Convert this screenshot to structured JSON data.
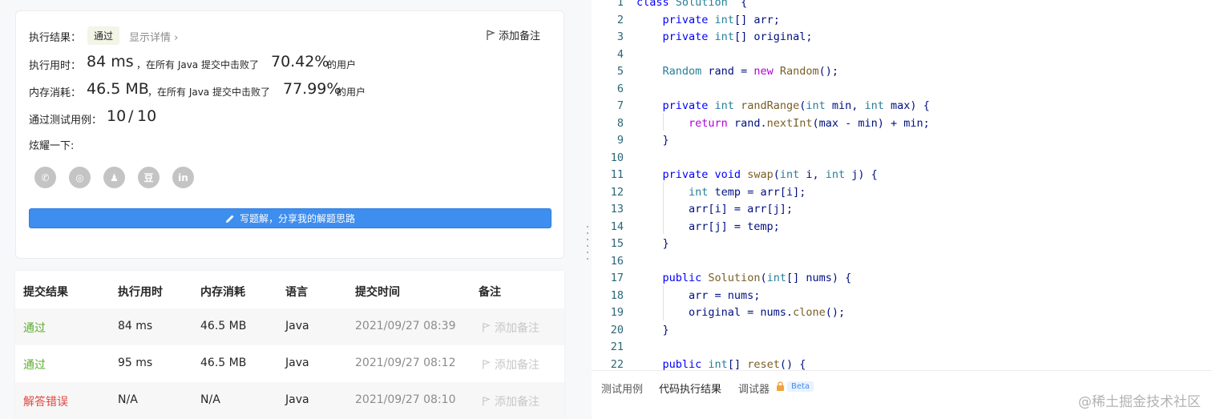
{
  "result_card": {
    "result_label": "执行结果：",
    "status_badge": "通过",
    "details_link": "显示详情 ›",
    "add_note": "添加备注",
    "runtime_label": "执行用时：",
    "runtime_value": "84 ms",
    "runtime_beat_text": "，在所有 Java 提交中击败了",
    "runtime_percent": "70.42%",
    "runtime_suffix": "的用户",
    "memory_label": "内存消耗：",
    "memory_value": "46.5 MB",
    "memory_beat_text": "，在所有 Java 提交中击败了",
    "memory_percent": "77.99%",
    "memory_suffix": "的用户",
    "tests_label": "通过测试用例：",
    "tests_passed": "10",
    "tests_separator": "/",
    "tests_total": "10",
    "share_label": "炫耀一下:",
    "social": [
      {
        "name": "wechat-icon",
        "glyph": "✆"
      },
      {
        "name": "weibo-icon",
        "glyph": "◎"
      },
      {
        "name": "qq-icon",
        "glyph": "♟"
      },
      {
        "name": "douban-icon",
        "glyph": "豆"
      },
      {
        "name": "linkedin-icon",
        "glyph": "in"
      }
    ],
    "solution_button": "写题解，分享我的解题思路"
  },
  "submissions": {
    "headers": [
      "提交结果",
      "执行用时",
      "内存消耗",
      "语言",
      "提交时间",
      "备注"
    ],
    "rows": [
      {
        "status": "通过",
        "status_type": "ok",
        "runtime": "84 ms",
        "memory": "46.5 MB",
        "lang": "Java",
        "time": "2021/09/27 08:39",
        "note": "添加备注"
      },
      {
        "status": "通过",
        "status_type": "ok",
        "runtime": "95 ms",
        "memory": "46.5 MB",
        "lang": "Java",
        "time": "2021/09/27 08:12",
        "note": "添加备注"
      },
      {
        "status": "解答错误",
        "status_type": "err",
        "runtime": "N/A",
        "memory": "N/A",
        "lang": "Java",
        "time": "2021/09/27 08:10",
        "note": "添加备注"
      }
    ]
  },
  "editor": {
    "line_numbers": [
      "1",
      "2",
      "3",
      "4",
      "5",
      "6",
      "7",
      "8",
      "9",
      "10",
      "11",
      "12",
      "13",
      "14",
      "15",
      "16",
      "17",
      "18",
      "19",
      "20",
      "21",
      "22"
    ],
    "lines": [
      [
        [
          "kw",
          "class "
        ],
        [
          "ty",
          "Solution"
        ],
        [
          "",
          "  {"
        ]
      ],
      [
        [
          "",
          "    "
        ],
        [
          "kw",
          "private "
        ],
        [
          "ty",
          "int"
        ],
        [
          "",
          "[] arr;"
        ]
      ],
      [
        [
          "",
          "    "
        ],
        [
          "kw",
          "private "
        ],
        [
          "ty",
          "int"
        ],
        [
          "",
          "[] original;"
        ]
      ],
      [],
      [
        [
          "",
          "    "
        ],
        [
          "ty",
          "Random"
        ],
        [
          "",
          " rand = "
        ],
        [
          "nw",
          "new "
        ],
        [
          "fn",
          "Random"
        ],
        [
          "",
          "();"
        ]
      ],
      [],
      [
        [
          "",
          "    "
        ],
        [
          "kw",
          "private "
        ],
        [
          "ty",
          "int "
        ],
        [
          "fn",
          "randRange"
        ],
        [
          "",
          "("
        ],
        [
          "ty",
          "int"
        ],
        [
          "",
          " min, "
        ],
        [
          "ty",
          "int"
        ],
        [
          "",
          " max) {"
        ]
      ],
      [
        [
          "",
          "        "
        ],
        [
          "nw",
          "return "
        ],
        [
          "",
          "rand."
        ],
        [
          "fn",
          "nextInt"
        ],
        [
          "",
          "(max - min) + min;"
        ]
      ],
      [
        [
          "",
          "    }"
        ]
      ],
      [],
      [
        [
          "",
          "    "
        ],
        [
          "kw",
          "private "
        ],
        [
          "kw",
          "void "
        ],
        [
          "fn",
          "swap"
        ],
        [
          "",
          "("
        ],
        [
          "ty",
          "int"
        ],
        [
          "",
          " i, "
        ],
        [
          "ty",
          "int"
        ],
        [
          "",
          " j) {"
        ]
      ],
      [
        [
          "",
          "        "
        ],
        [
          "ty",
          "int"
        ],
        [
          "",
          " temp = arr[i];"
        ]
      ],
      [
        [
          "",
          "        arr[i] = arr[j];"
        ]
      ],
      [
        [
          "",
          "        arr[j] = temp;"
        ]
      ],
      [
        [
          "",
          "    }"
        ]
      ],
      [],
      [
        [
          "",
          "    "
        ],
        [
          "kw",
          "public "
        ],
        [
          "fn",
          "Solution"
        ],
        [
          "",
          "("
        ],
        [
          "ty",
          "int"
        ],
        [
          "",
          "[] nums) {"
        ]
      ],
      [
        [
          "",
          "        arr = nums;"
        ]
      ],
      [
        [
          "",
          "        original = nums."
        ],
        [
          "fn",
          "clone"
        ],
        [
          "",
          "();"
        ]
      ],
      [
        [
          "",
          "    }"
        ]
      ],
      [],
      [
        [
          "",
          "    "
        ],
        [
          "kw",
          "public "
        ],
        [
          "ty",
          "int"
        ],
        [
          "",
          "[] "
        ],
        [
          "fn",
          "reset"
        ],
        [
          "",
          "() {"
        ]
      ]
    ]
  },
  "console_tabs": {
    "testcase": "测试用例",
    "result": "代码执行结果",
    "debugger": "调试器",
    "beta": "Beta"
  },
  "watermark": "@稀土掘金技术社区",
  "colors": {
    "accent": "#3e8eef",
    "pass": "#5cad2f",
    "error": "#e1463f"
  }
}
